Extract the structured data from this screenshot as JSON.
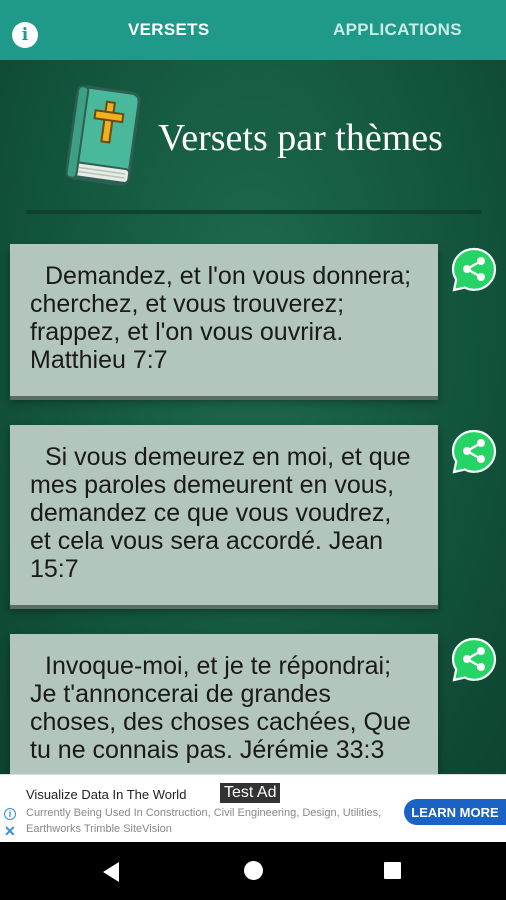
{
  "topbar": {
    "info_icon": "i",
    "tabs": [
      {
        "label": "VERSETS",
        "active": true
      },
      {
        "label": "APPLICATIONS",
        "active": false
      }
    ]
  },
  "header": {
    "title": "Versets par thèmes"
  },
  "verses": [
    {
      "text": "Demandez, et l'on vous donnera; cherchez, et vous trouverez; frappez, et l'on vous ouvrira. Matthieu 7:7"
    },
    {
      "text": "Si vous demeurez en moi, et que mes paroles demeurent en vous, demandez ce que vous voudrez, et cela vous sera accordé. Jean 15:7"
    },
    {
      "text": "Invoque-moi, et je te répondrai; Je t'annoncerai de grandes choses, des choses cachées, Que tu ne connais pas. Jérémie 33:3"
    }
  ],
  "ad": {
    "title": "Visualize Data In The World",
    "badge": "Test Ad",
    "description": "Currently Being Used In Construction, Civil Engineering, Design, Utilities, Earthworks Trimble SiteVision",
    "cta": "LEARN MORE",
    "close": "✕"
  },
  "colors": {
    "accent": "#1f9a8a",
    "background": "#155a40",
    "card": "#b2c6bd",
    "share": "#25d366",
    "ad_cta": "#1a63c4"
  },
  "icons": [
    "info-icon",
    "bible-icon",
    "share-icon",
    "ad-info-icon",
    "close-icon",
    "back-icon",
    "home-icon",
    "recents-icon"
  ]
}
